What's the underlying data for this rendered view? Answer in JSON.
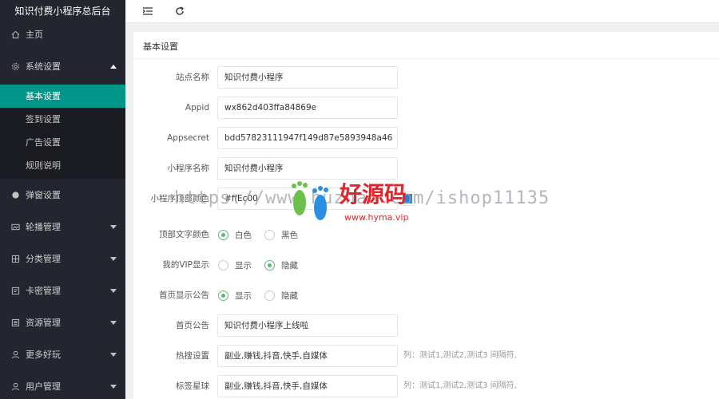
{
  "app": {
    "title": "知识付费小程序总后台"
  },
  "sidebar": {
    "items": [
      {
        "label": "主页",
        "icon": "home-icon"
      },
      {
        "label": "系统设置",
        "icon": "gear-icon"
      },
      {
        "label": "弹窗设置",
        "icon": "circle-icon"
      },
      {
        "label": "轮播管理",
        "icon": "image-icon"
      },
      {
        "label": "分类管理",
        "icon": "category-icon"
      },
      {
        "label": "卡密管理",
        "icon": "card-icon"
      },
      {
        "label": "资源管理",
        "icon": "resource-icon"
      },
      {
        "label": "更多好玩",
        "icon": "fun-icon"
      },
      {
        "label": "用户管理",
        "icon": "user-icon"
      }
    ],
    "sub_items": [
      {
        "label": "基本设置"
      },
      {
        "label": "签到设置"
      },
      {
        "label": "广告设置"
      },
      {
        "label": "规则说明"
      }
    ]
  },
  "toolbar": {
    "menu_icon": "menu-toggle-icon",
    "refresh_icon": "refresh-icon"
  },
  "card": {
    "title": "基本设置"
  },
  "form": {
    "site_name": {
      "label": "站点名称",
      "value": "知识付费小程序"
    },
    "appid": {
      "label": "Appid",
      "value": "wx862d403ffa84869e"
    },
    "appsecret": {
      "label": "Appsecret",
      "value": "bdd57823111947f149d87e5893948a46"
    },
    "mini_name": {
      "label": "小程序名称",
      "value": "知识付费小程序"
    },
    "top_color": {
      "label": "小程序顶部颜色",
      "value": "#ffEc00",
      "swatch": "#2b7fd7"
    },
    "top_text_color": {
      "label": "顶部文字颜色",
      "options": [
        "白色",
        "黑色"
      ],
      "selected": "白色"
    },
    "vip_display": {
      "label": "我的VIP显示",
      "options": [
        "显示",
        "隐藏"
      ],
      "selected": "隐藏"
    },
    "home_notice_display": {
      "label": "首页显示公告",
      "options": [
        "显示",
        "隐藏"
      ],
      "selected": "显示"
    },
    "home_notice": {
      "label": "首页公告",
      "value": "知识付费小程序上线啦"
    },
    "hot_search": {
      "label": "热搜设置",
      "value": "副业,赚钱,抖音,快手,自媒体",
      "hint": "列：测试1,测试2,测试3 间隔符,"
    },
    "tag_planet": {
      "label": "标签星球",
      "value": "副业,赚钱,抖音,快手,自媒体",
      "hint": "列：测试1,测试2,测试3 间隔符,"
    }
  },
  "watermark": {
    "text": "https://www.huzhan.com/ishop11135",
    "logo_cn": "好源码",
    "logo_url": "www.hyma.vip",
    "colors": {
      "feet_green": "#6cc04a",
      "feet_blue": "#2a8fe0",
      "brand_red": "#e0262d"
    }
  },
  "colors": {
    "sidebar_bg": "#23262e",
    "active": "#009688",
    "radio_checked": "#5fb878"
  }
}
